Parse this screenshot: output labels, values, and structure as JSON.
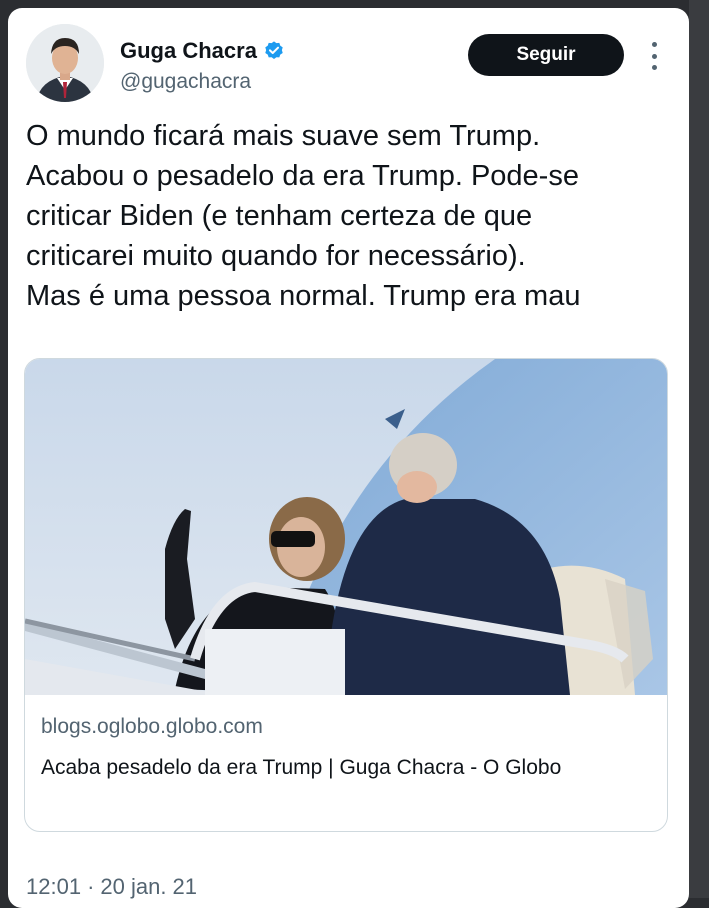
{
  "author": {
    "name": "Guga Chacra",
    "handle": "@gugachacra",
    "avatar": "user-avatar-photo",
    "verified_icon": "verified-badge-icon",
    "verified_color": "#1d9bf0"
  },
  "actions": {
    "follow_label": "Seguir",
    "more_icon": "more-vertical-icon"
  },
  "tweet": {
    "lines": [
      "O mundo ficará mais suave sem Trump.",
      "Acabou o pesadelo da era Trump. Pode-se",
      "criticar Biden (e tenham certeza de que",
      "criticarei muito quando for necessário).",
      "Mas é uma pessoa normal. Trump era mau"
    ],
    "time": "12:01",
    "separator": "·",
    "date": "20 jan. 21"
  },
  "link_card": {
    "domain": "blogs.oglobo.globo.com",
    "title": "Acaba pesadelo da era Trump | Guga Chacra - O Globo"
  },
  "colors": {
    "text_primary": "#0f1419",
    "text_secondary": "#536471",
    "button_bg": "#0f1419",
    "card_border": "#cfd9de"
  }
}
